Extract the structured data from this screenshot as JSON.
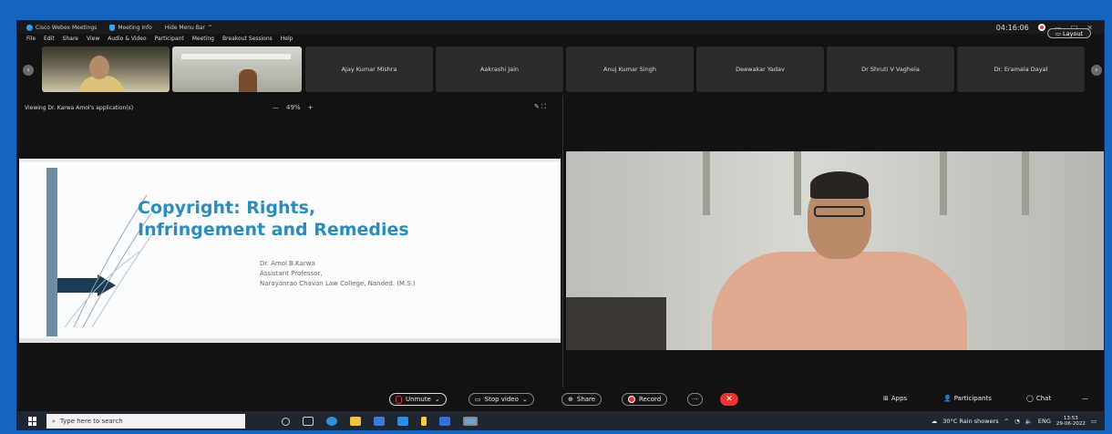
{
  "titlebar": {
    "app_name": "Cisco Webex Meetings",
    "meeting_info": "Meeting Info",
    "hide_menu": "Hide Menu Bar",
    "hide_menu_chevron": "^",
    "time": "04:16:06",
    "window_controls": [
      "—",
      "□",
      "✕"
    ]
  },
  "menubar": [
    "File",
    "Edit",
    "Share",
    "View",
    "Audio & Video",
    "Participant",
    "Meeting",
    "Breakout Sessions",
    "Help"
  ],
  "participants": [
    "Ajay Kumar Mishra",
    "Aakrashi Jain",
    "Anuj Kumar Singh",
    "Deewakar Yadav",
    "Dr Shruti V Vaghela",
    "Dr. Eramala Dayal"
  ],
  "layout_button": "Layout",
  "viewing": {
    "text": "Viewing Dr. Karwa Amol's application(s)",
    "zoom_minus": "—",
    "zoom_level": "49%",
    "zoom_plus": "+"
  },
  "slide": {
    "title_line1": "Copyright: Rights,",
    "title_line2": "Infringement and Remedies",
    "author": "Dr. Amol B.Karwa",
    "role": "Assistant Professor,",
    "college": "Narayanrao Chavan Law College, Nanded. (M.S.)"
  },
  "controls": {
    "unmute": "Unmute",
    "stop_video": "Stop video",
    "share": "Share",
    "record": "Record",
    "more": "···",
    "end": "✕",
    "apps": "Apps",
    "participants": "Participants",
    "chat": "Chat",
    "overflow": "—"
  },
  "taskbar": {
    "search_placeholder": "Type here to search",
    "weather": "30°C  Rain showers",
    "lang": "ENG",
    "clock_time": "13:53",
    "clock_date": "29-06-2022"
  },
  "colors": {
    "outer_border": "#1565c0",
    "slide_title": "#2e8cb9",
    "end_call": "#e8342c",
    "record_dot": "#e33"
  }
}
